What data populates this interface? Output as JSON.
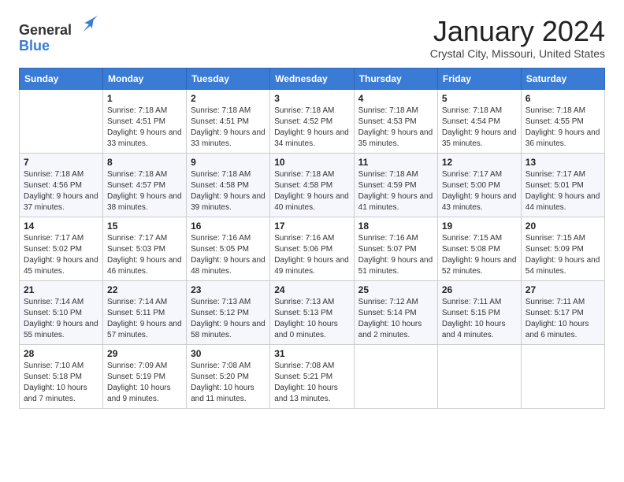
{
  "logo": {
    "general": "General",
    "blue": "Blue"
  },
  "title": "January 2024",
  "location": "Crystal City, Missouri, United States",
  "days_of_week": [
    "Sunday",
    "Monday",
    "Tuesday",
    "Wednesday",
    "Thursday",
    "Friday",
    "Saturday"
  ],
  "weeks": [
    [
      {
        "day": "",
        "sunrise": "",
        "sunset": "",
        "daylight": ""
      },
      {
        "day": "1",
        "sunrise": "Sunrise: 7:18 AM",
        "sunset": "Sunset: 4:51 PM",
        "daylight": "Daylight: 9 hours and 33 minutes."
      },
      {
        "day": "2",
        "sunrise": "Sunrise: 7:18 AM",
        "sunset": "Sunset: 4:51 PM",
        "daylight": "Daylight: 9 hours and 33 minutes."
      },
      {
        "day": "3",
        "sunrise": "Sunrise: 7:18 AM",
        "sunset": "Sunset: 4:52 PM",
        "daylight": "Daylight: 9 hours and 34 minutes."
      },
      {
        "day": "4",
        "sunrise": "Sunrise: 7:18 AM",
        "sunset": "Sunset: 4:53 PM",
        "daylight": "Daylight: 9 hours and 35 minutes."
      },
      {
        "day": "5",
        "sunrise": "Sunrise: 7:18 AM",
        "sunset": "Sunset: 4:54 PM",
        "daylight": "Daylight: 9 hours and 35 minutes."
      },
      {
        "day": "6",
        "sunrise": "Sunrise: 7:18 AM",
        "sunset": "Sunset: 4:55 PM",
        "daylight": "Daylight: 9 hours and 36 minutes."
      }
    ],
    [
      {
        "day": "7",
        "sunrise": "Sunrise: 7:18 AM",
        "sunset": "Sunset: 4:56 PM",
        "daylight": "Daylight: 9 hours and 37 minutes."
      },
      {
        "day": "8",
        "sunrise": "Sunrise: 7:18 AM",
        "sunset": "Sunset: 4:57 PM",
        "daylight": "Daylight: 9 hours and 38 minutes."
      },
      {
        "day": "9",
        "sunrise": "Sunrise: 7:18 AM",
        "sunset": "Sunset: 4:58 PM",
        "daylight": "Daylight: 9 hours and 39 minutes."
      },
      {
        "day": "10",
        "sunrise": "Sunrise: 7:18 AM",
        "sunset": "Sunset: 4:58 PM",
        "daylight": "Daylight: 9 hours and 40 minutes."
      },
      {
        "day": "11",
        "sunrise": "Sunrise: 7:18 AM",
        "sunset": "Sunset: 4:59 PM",
        "daylight": "Daylight: 9 hours and 41 minutes."
      },
      {
        "day": "12",
        "sunrise": "Sunrise: 7:17 AM",
        "sunset": "Sunset: 5:00 PM",
        "daylight": "Daylight: 9 hours and 43 minutes."
      },
      {
        "day": "13",
        "sunrise": "Sunrise: 7:17 AM",
        "sunset": "Sunset: 5:01 PM",
        "daylight": "Daylight: 9 hours and 44 minutes."
      }
    ],
    [
      {
        "day": "14",
        "sunrise": "Sunrise: 7:17 AM",
        "sunset": "Sunset: 5:02 PM",
        "daylight": "Daylight: 9 hours and 45 minutes."
      },
      {
        "day": "15",
        "sunrise": "Sunrise: 7:17 AM",
        "sunset": "Sunset: 5:03 PM",
        "daylight": "Daylight: 9 hours and 46 minutes."
      },
      {
        "day": "16",
        "sunrise": "Sunrise: 7:16 AM",
        "sunset": "Sunset: 5:05 PM",
        "daylight": "Daylight: 9 hours and 48 minutes."
      },
      {
        "day": "17",
        "sunrise": "Sunrise: 7:16 AM",
        "sunset": "Sunset: 5:06 PM",
        "daylight": "Daylight: 9 hours and 49 minutes."
      },
      {
        "day": "18",
        "sunrise": "Sunrise: 7:16 AM",
        "sunset": "Sunset: 5:07 PM",
        "daylight": "Daylight: 9 hours and 51 minutes."
      },
      {
        "day": "19",
        "sunrise": "Sunrise: 7:15 AM",
        "sunset": "Sunset: 5:08 PM",
        "daylight": "Daylight: 9 hours and 52 minutes."
      },
      {
        "day": "20",
        "sunrise": "Sunrise: 7:15 AM",
        "sunset": "Sunset: 5:09 PM",
        "daylight": "Daylight: 9 hours and 54 minutes."
      }
    ],
    [
      {
        "day": "21",
        "sunrise": "Sunrise: 7:14 AM",
        "sunset": "Sunset: 5:10 PM",
        "daylight": "Daylight: 9 hours and 55 minutes."
      },
      {
        "day": "22",
        "sunrise": "Sunrise: 7:14 AM",
        "sunset": "Sunset: 5:11 PM",
        "daylight": "Daylight: 9 hours and 57 minutes."
      },
      {
        "day": "23",
        "sunrise": "Sunrise: 7:13 AM",
        "sunset": "Sunset: 5:12 PM",
        "daylight": "Daylight: 9 hours and 58 minutes."
      },
      {
        "day": "24",
        "sunrise": "Sunrise: 7:13 AM",
        "sunset": "Sunset: 5:13 PM",
        "daylight": "Daylight: 10 hours and 0 minutes."
      },
      {
        "day": "25",
        "sunrise": "Sunrise: 7:12 AM",
        "sunset": "Sunset: 5:14 PM",
        "daylight": "Daylight: 10 hours and 2 minutes."
      },
      {
        "day": "26",
        "sunrise": "Sunrise: 7:11 AM",
        "sunset": "Sunset: 5:15 PM",
        "daylight": "Daylight: 10 hours and 4 minutes."
      },
      {
        "day": "27",
        "sunrise": "Sunrise: 7:11 AM",
        "sunset": "Sunset: 5:17 PM",
        "daylight": "Daylight: 10 hours and 6 minutes."
      }
    ],
    [
      {
        "day": "28",
        "sunrise": "Sunrise: 7:10 AM",
        "sunset": "Sunset: 5:18 PM",
        "daylight": "Daylight: 10 hours and 7 minutes."
      },
      {
        "day": "29",
        "sunrise": "Sunrise: 7:09 AM",
        "sunset": "Sunset: 5:19 PM",
        "daylight": "Daylight: 10 hours and 9 minutes."
      },
      {
        "day": "30",
        "sunrise": "Sunrise: 7:08 AM",
        "sunset": "Sunset: 5:20 PM",
        "daylight": "Daylight: 10 hours and 11 minutes."
      },
      {
        "day": "31",
        "sunrise": "Sunrise: 7:08 AM",
        "sunset": "Sunset: 5:21 PM",
        "daylight": "Daylight: 10 hours and 13 minutes."
      },
      {
        "day": "",
        "sunrise": "",
        "sunset": "",
        "daylight": ""
      },
      {
        "day": "",
        "sunrise": "",
        "sunset": "",
        "daylight": ""
      },
      {
        "day": "",
        "sunrise": "",
        "sunset": "",
        "daylight": ""
      }
    ]
  ]
}
